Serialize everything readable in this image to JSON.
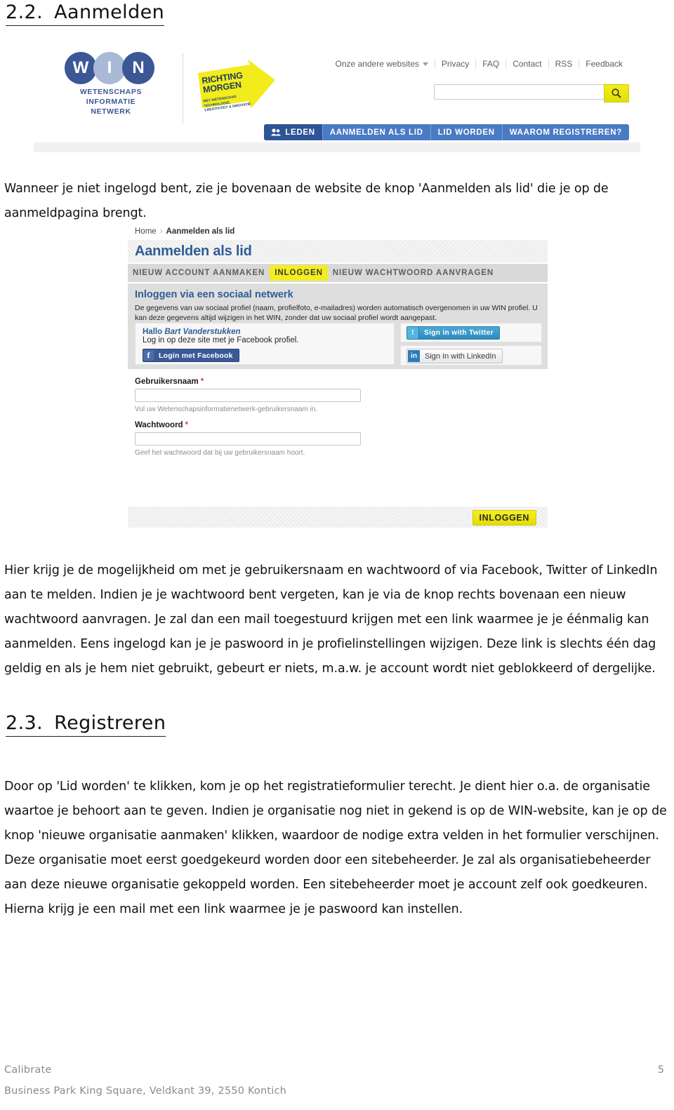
{
  "sections": {
    "s22": {
      "number": "2.2.",
      "title": "Aanmelden"
    },
    "s23": {
      "number": "2.3.",
      "title": "Registreren"
    }
  },
  "paragraphs": {
    "p1": "Wanneer je niet ingelogd bent, zie je bovenaan de website de knop 'Aanmelden als lid' die je op de aanmeldpagina brengt.",
    "p2": "Hier krijg je de mogelijkheid om met je gebruikersnaam en wachtwoord of via Facebook, Twitter of LinkedIn aan te melden. Indien je je wachtwoord bent vergeten, kan je via de knop rechts bovenaan een nieuw wachtwoord aanvragen. Je zal dan een mail toegestuurd krijgen met een link waarmee je je éénmalig kan aanmelden. Eens ingelogd kan je je paswoord in je profielinstellingen wijzigen. Deze link is slechts één dag geldig en als je hem niet gebruikt, gebeurt er niets, m.a.w. je account wordt niet geblokkeerd of dergelijke.",
    "p3": "Door op 'Lid worden' te klikken, kom je op het registratieformulier terecht. Je dient hier o.a. de organisatie waartoe je behoort aan te geven. Indien je organisatie nog niet in gekend is op de WIN-website, kan je op de knop 'nieuwe organisatie aanmaken' klikken, waardoor de nodige extra velden in het formulier verschijnen. Deze organisatie moet eerst goedgekeurd worden door een sitebeheerder. Je zal als organisatiebeheerder aan deze nieuwe organisatie gekoppeld worden. Een sitebeheerder moet je account zelf ook goedkeuren. Hierna krijg je een mail met een link waarmee je je paswoord kan instellen."
  },
  "screenshot_header": {
    "logo": {
      "letters": [
        "W",
        "I",
        "N"
      ],
      "words": "WETENSCHAPS INFORMATIE NETWERK",
      "word_lines": [
        "WETENSCHAPS",
        "INFORMATIE",
        "NETWERK"
      ],
      "arrow_title_line1": "RICHTING",
      "arrow_title_line2": "MORGEN",
      "arrow_sub_line1": "MET WETENSCHAP, TECHNOLOGIE,",
      "arrow_sub_line2": "CREATIVITEIT & INNOVATIE",
      "circle_dark": "#3b5795",
      "circle_light": "#a9b9d6",
      "arrow_yellow": "#f2ec1c"
    },
    "topnav": {
      "dropdown_label": "Onze andere websites",
      "items": [
        "Privacy",
        "FAQ",
        "Contact",
        "RSS",
        "Feedback"
      ]
    },
    "search": {
      "value": "",
      "placeholder": "",
      "icon": "search-icon"
    },
    "memberbar": {
      "active": "LEDEN",
      "items": [
        "AANMELDEN ALS LID",
        "LID WORDEN",
        "WAAROM REGISTREREN?"
      ],
      "active_color": "#2d5596",
      "bar_color": "#4a7ac4"
    }
  },
  "screenshot_login": {
    "breadcrumb": {
      "home": "Home",
      "separator": "›",
      "current": "Aanmelden als lid"
    },
    "page_title": "Aanmelden als lid",
    "tabs": [
      {
        "label": "NIEUW ACCOUNT AANMAKEN",
        "active": false
      },
      {
        "label": "INLOGGEN",
        "active": true
      },
      {
        "label": "NIEUW WACHTWOORD AANVRAGEN",
        "active": false
      }
    ],
    "social": {
      "heading": "Inloggen via een sociaal netwerk",
      "description": "De gegevens van uw sociaal profiel (naam, profielfoto, e-mailadres) worden automatisch overgenomen in uw WIN profiel. U kan deze gegevens altijd wijzigen in het WIN, zonder dat uw sociaal profiel wordt aangepast.",
      "hello_prefix": "Hallo ",
      "user_name": "Bart Vanderstukken",
      "facebook_line": "Log in op deze site met je Facebook profiel.",
      "facebook_button": "Login met Facebook",
      "twitter_button": "Sign in with Twitter",
      "linkedin_button": "Sign In with LinkedIn",
      "facebook_color": "#3b5998",
      "twitter_color": "#2e8cbd",
      "linkedin_color": "#2b7bb9"
    },
    "form": {
      "username_label": "Gebruikersnaam",
      "username_value": "",
      "username_help": "Vul uw Wetenschapsinformatienetwerk-gebruikersnaam in.",
      "password_label": "Wachtwoord",
      "password_value": "",
      "password_help": "Geef het wachtwoord dat bij uw gebruikersnaam hoort.",
      "required_marker": "*",
      "submit_label": "INLOGGEN",
      "submit_color": "#f2ee1f"
    }
  },
  "footer": {
    "company": "Calibrate",
    "address": "Business Park King Square, Veldkant 39, 2550 Kontich",
    "page_number": "5"
  }
}
